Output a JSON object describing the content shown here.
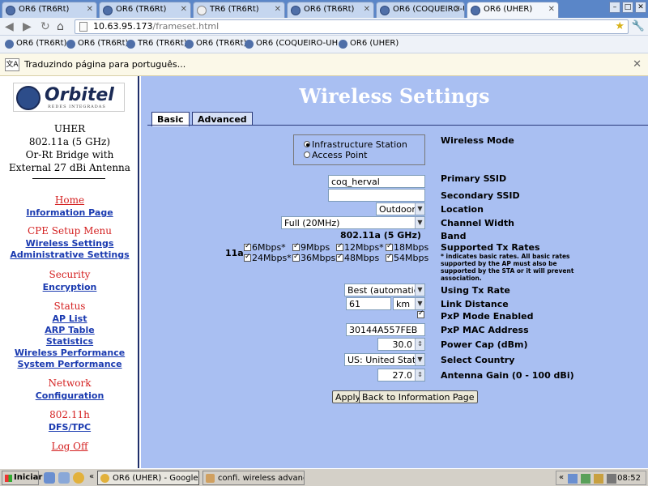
{
  "browser": {
    "tabs": [
      {
        "label": "OR6 (TR6Rt)",
        "active": false
      },
      {
        "label": "OR6 (TR6Rt)",
        "active": false
      },
      {
        "label": "TR6 (TR6Rt)",
        "active": false
      },
      {
        "label": "OR6 (TR6Rt)",
        "active": false
      },
      {
        "label": "OR6 (COQUEIRO-UI",
        "active": false
      },
      {
        "label": "OR6 (UHER)",
        "active": true
      }
    ],
    "url_host": "10.63.95.173",
    "url_path": "/frameset.html",
    "bookmarks": [
      "OR6 (TR6Rt)",
      "OR6 (TR6Rt)",
      "TR6 (TR6Rt)",
      "OR6 (TR6Rt)",
      "OR6 (COQUEIRO-UH...",
      "OR6 (UHER)"
    ],
    "translate_text": "Traduzindo página para português..."
  },
  "sidebar": {
    "logo_name": "Orbitel",
    "logo_sub": "REDES INTEGRADAS",
    "device_lines": [
      "UHER",
      "802.11a (5 GHz)",
      "Or-Rt Bridge with",
      "External 27 dBi Antenna"
    ],
    "home": "Home",
    "information_page": "Information Page",
    "cpe_setup_menu": "CPE Setup Menu",
    "wireless_settings": "Wireless Settings",
    "administrative_settings": "Administrative Settings",
    "security": "Security",
    "encryption": "Encryption",
    "status": "Status",
    "ap_list": "AP List",
    "arp_table": "ARP Table",
    "statistics": "Statistics",
    "wireless_performance": "Wireless Performance",
    "system_performance": "System Performance",
    "network": "Network",
    "configuration": "Configuration",
    "section_80211h": "802.11h",
    "dfs_tpc": "DFS/TPC",
    "log_off": "Log Off"
  },
  "main": {
    "title": "Wireless Settings",
    "tabs": {
      "basic": "Basic",
      "advanced": "Advanced"
    },
    "wireless_mode": {
      "label": "Wireless Mode",
      "infrastructure": "Infrastructure Station",
      "access_point": "Access Point",
      "selected": "infrastructure"
    },
    "primary_ssid": {
      "label": "Primary SSID",
      "value": "coq_herval"
    },
    "secondary_ssid": {
      "label": "Secondary SSID",
      "value": ""
    },
    "location": {
      "label": "Location",
      "value": "Outdoor"
    },
    "channel_width": {
      "label": "Channel Width",
      "value": "Full (20MHz)"
    },
    "band": {
      "label": "Band",
      "value": "802.11a (5 GHz)"
    },
    "tx_rates": {
      "label": "Supported Tx Rates",
      "prefix": "11a",
      "note": "* indicates basic rates. All basic rates supported by the AP must also be supported by the STA or it will prevent association.",
      "rates": [
        "6Mbps*",
        "9Mbps",
        "12Mbps*",
        "18Mbps",
        "24Mbps*",
        "36Mbps",
        "48Mbps",
        "54Mbps"
      ]
    },
    "using_tx_rate": {
      "label": "Using Tx Rate",
      "value": "Best (automatic)"
    },
    "link_distance": {
      "label": "Link Distance",
      "value": "61",
      "unit": "km"
    },
    "pxp_mode": {
      "label": "PxP Mode Enabled",
      "checked": true
    },
    "pxp_mac": {
      "label": "PxP MAC Address",
      "value": "30144A557FEB"
    },
    "power_cap": {
      "label": "Power Cap (dBm)",
      "value": "30.0"
    },
    "country": {
      "label": "Select Country",
      "value": "US: United States"
    },
    "antenna_gain": {
      "label": "Antenna Gain (0 - 100 dBi)",
      "value": "27.0"
    },
    "apply": "Apply",
    "back": "Back to Information Page"
  },
  "taskbar": {
    "start": "Iniciar",
    "tasks": [
      "OR6 (UHER) - Google ...",
      "confi. wireless advanced..."
    ],
    "clock": "08:52",
    "chevron": "«"
  }
}
